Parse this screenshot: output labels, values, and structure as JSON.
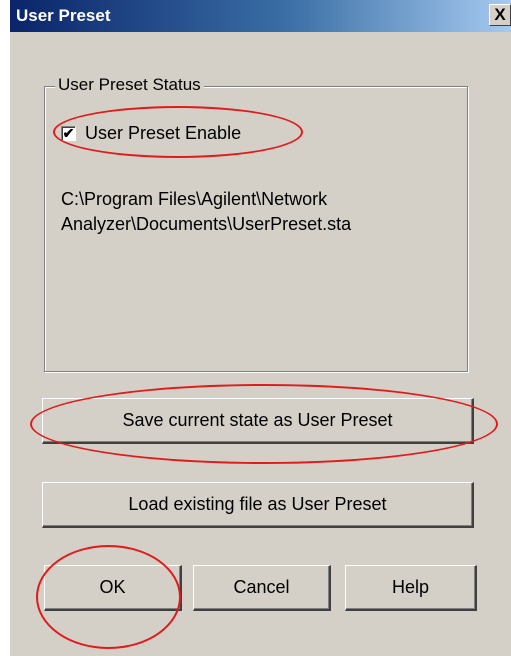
{
  "window": {
    "title": "User Preset",
    "close_label": "X"
  },
  "group": {
    "legend": "User Preset Status",
    "checkbox": {
      "label": "User Preset Enable",
      "checked": true
    },
    "path_line1": "C:\\Program Files\\Agilent\\Network",
    "path_line2": "Analyzer\\Documents\\UserPreset.sta"
  },
  "buttons": {
    "save": "Save current state as User Preset",
    "load": "Load existing file as User Preset",
    "ok": "OK",
    "cancel": "Cancel",
    "help": "Help"
  },
  "annotation_color": "#e11a1a",
  "checkmark_glyph": "✔"
}
